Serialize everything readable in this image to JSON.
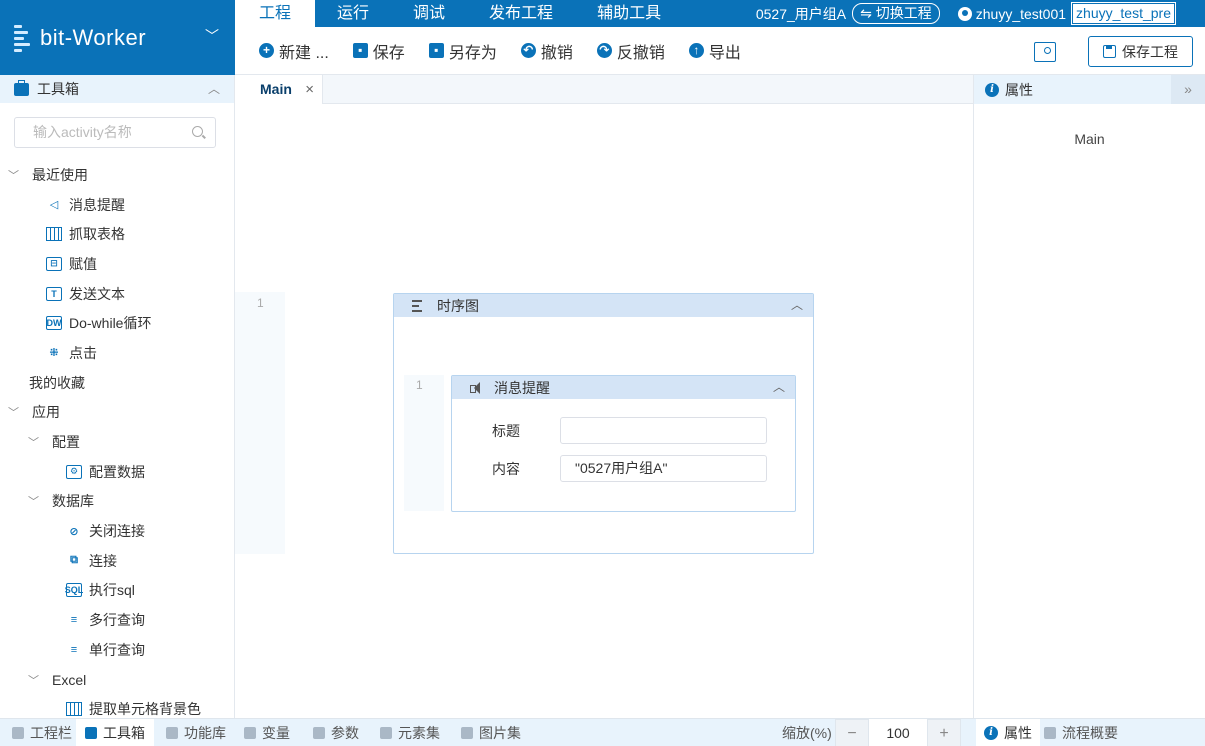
{
  "app": {
    "name": "bit-Worker"
  },
  "menu": {
    "tabs": [
      "工程",
      "运行",
      "调试",
      "发布工程",
      "辅助工具"
    ],
    "project_group": "0527_用户组A",
    "switch_label": "⇋ 切换工程",
    "username": "zhuyy_test001",
    "environment": "zhuyy_test_pre"
  },
  "toolbar": {
    "new_label": "新建 ...",
    "save_label": "保存",
    "save_as_label": "另存为",
    "undo_label": "撤销",
    "redo_label": "反撤销",
    "export_label": "导出",
    "save_project_label": "保存工程"
  },
  "sidebar": {
    "title": "工具箱",
    "search_placeholder": "输入activity名称",
    "tree": [
      {
        "label": "最近使用",
        "caret": "﹀",
        "indent": 0
      },
      {
        "label": "消息提醒",
        "icon": "speaker-icon",
        "indent": 2
      },
      {
        "label": "抓取表格",
        "icon": "table-icon",
        "indent": 2
      },
      {
        "label": "赋值",
        "icon": "assign-icon",
        "indent": 2
      },
      {
        "label": "发送文本",
        "icon": "text-icon",
        "indent": 2
      },
      {
        "label": "Do-while循环",
        "icon": "loop-icon",
        "indent": 2
      },
      {
        "label": "点击",
        "icon": "click-icon",
        "indent": 2
      },
      {
        "label": "我的收藏",
        "indent": 0,
        "nocaret": true
      },
      {
        "label": "应用",
        "caret": "﹀",
        "indent": 0
      },
      {
        "label": "配置",
        "caret": "﹀",
        "indent": 1
      },
      {
        "label": "配置数据",
        "icon": "config-icon",
        "indent": 3
      },
      {
        "label": "数据库",
        "caret": "﹀",
        "indent": 1
      },
      {
        "label": "关闭连接",
        "icon": "disconnect-icon",
        "indent": 3
      },
      {
        "label": "连接",
        "icon": "connect-icon",
        "indent": 3
      },
      {
        "label": "执行sql",
        "icon": "sql-icon",
        "indent": 3
      },
      {
        "label": "多行查询",
        "icon": "multi-query-icon",
        "indent": 3
      },
      {
        "label": "单行查询",
        "icon": "single-query-icon",
        "indent": 3
      },
      {
        "label": "Excel",
        "caret": "﹀",
        "indent": 1
      },
      {
        "label": "提取单元格背景色",
        "icon": "table-icon",
        "indent": 3
      }
    ]
  },
  "editor": {
    "tab_label": "Main",
    "sequence": {
      "line": "1",
      "title": "时序图"
    },
    "activity": {
      "line": "1",
      "title": "消息提醒",
      "title_label": "标题",
      "title_value": "",
      "content_label": "内容",
      "content_value": "\"0527用户组A\""
    }
  },
  "properties": {
    "title": "属性",
    "main_label": "Main"
  },
  "bottom": {
    "tabs": [
      "工程栏",
      "工具箱",
      "功能库",
      "变量",
      "参数",
      "元素集",
      "图片集"
    ],
    "zoom_label": "缩放(%)",
    "zoom_value": "100",
    "right_tabs": [
      "属性",
      "流程概要"
    ]
  }
}
